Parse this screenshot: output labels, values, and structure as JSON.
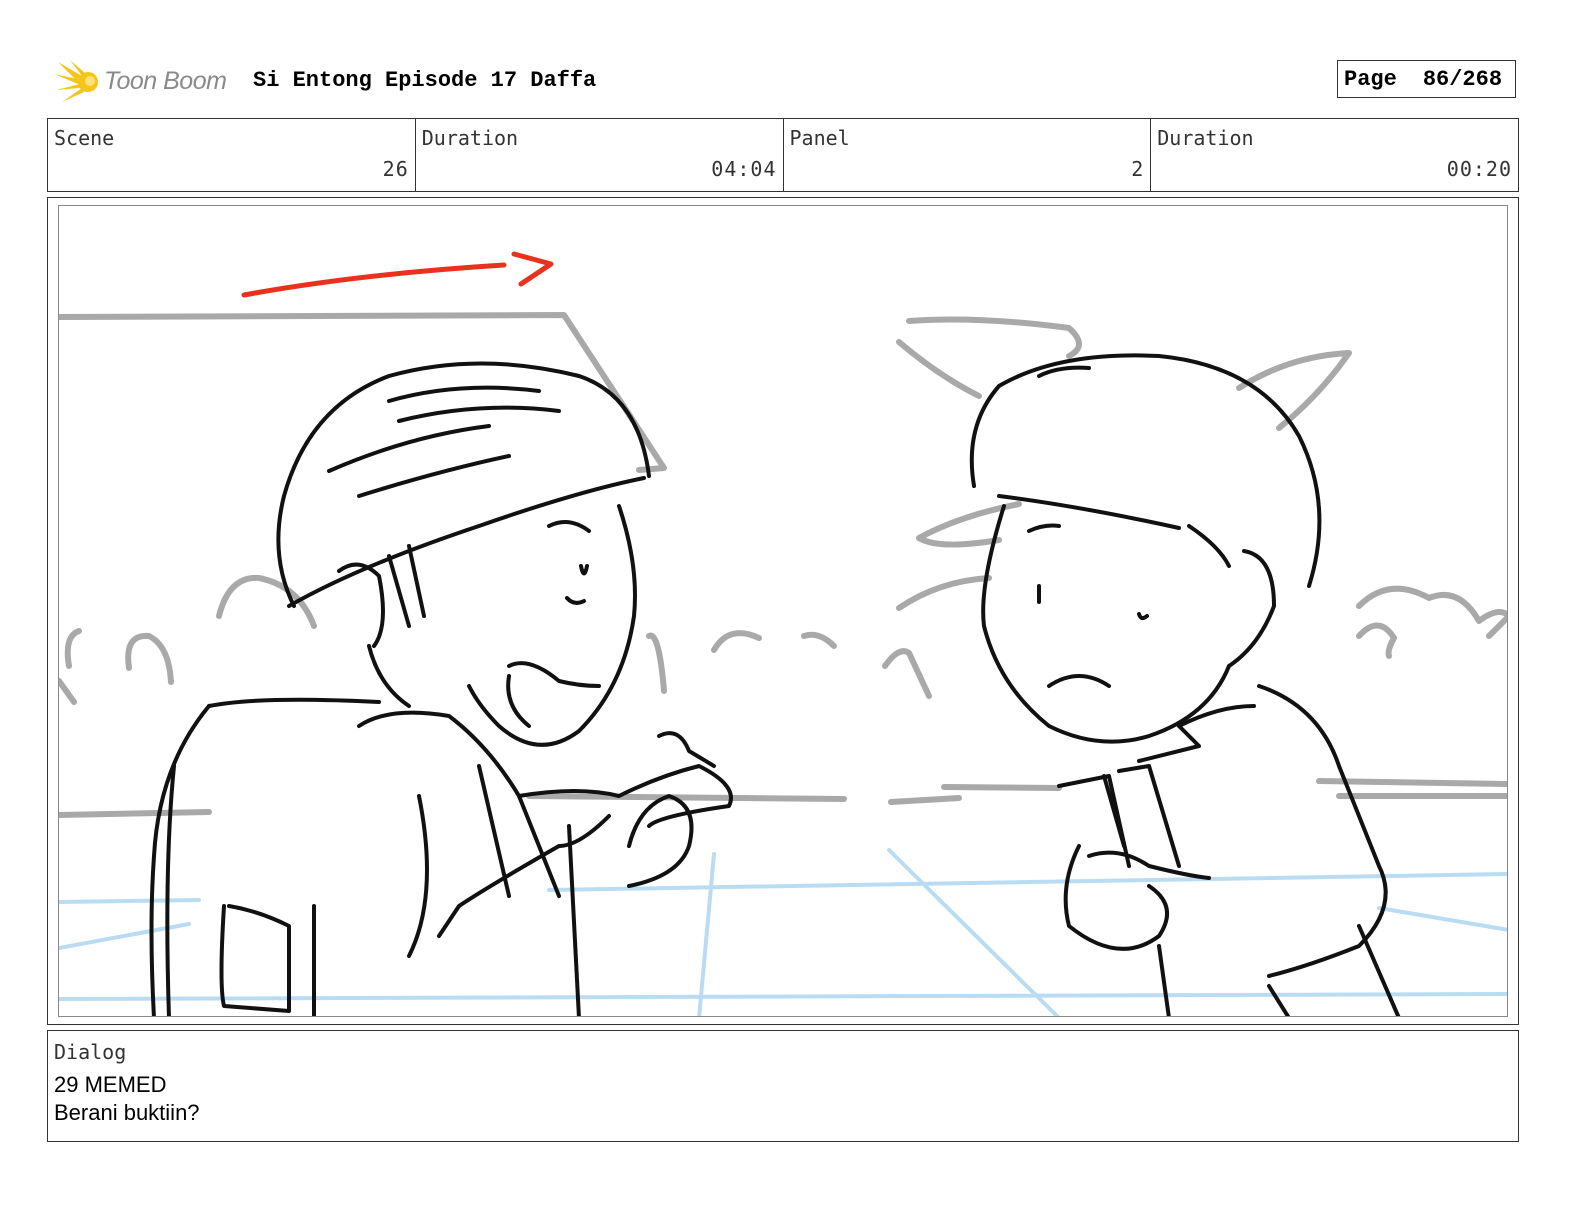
{
  "header": {
    "logo_text": "Toon Boom",
    "title": "Si Entong Episode 17 Daffa",
    "page_label": "Page",
    "page_value": "86/268"
  },
  "info": {
    "scene_label": "Scene",
    "scene_value": "26",
    "scene_duration_label": "Duration",
    "scene_duration_value": "04:04",
    "panel_label": "Panel",
    "panel_value": "2",
    "panel_duration_label": "Duration",
    "panel_duration_value": "00:20"
  },
  "dialog": {
    "label": "Dialog",
    "line1": "29 MEMED",
    "line2": "Berani buktiin?"
  },
  "colors": {
    "logo_yellow": "#f5c518",
    "camera_arrow": "#e8321e",
    "background_lines": "#a9a9a9",
    "floor_lines": "#b9dcf2"
  }
}
